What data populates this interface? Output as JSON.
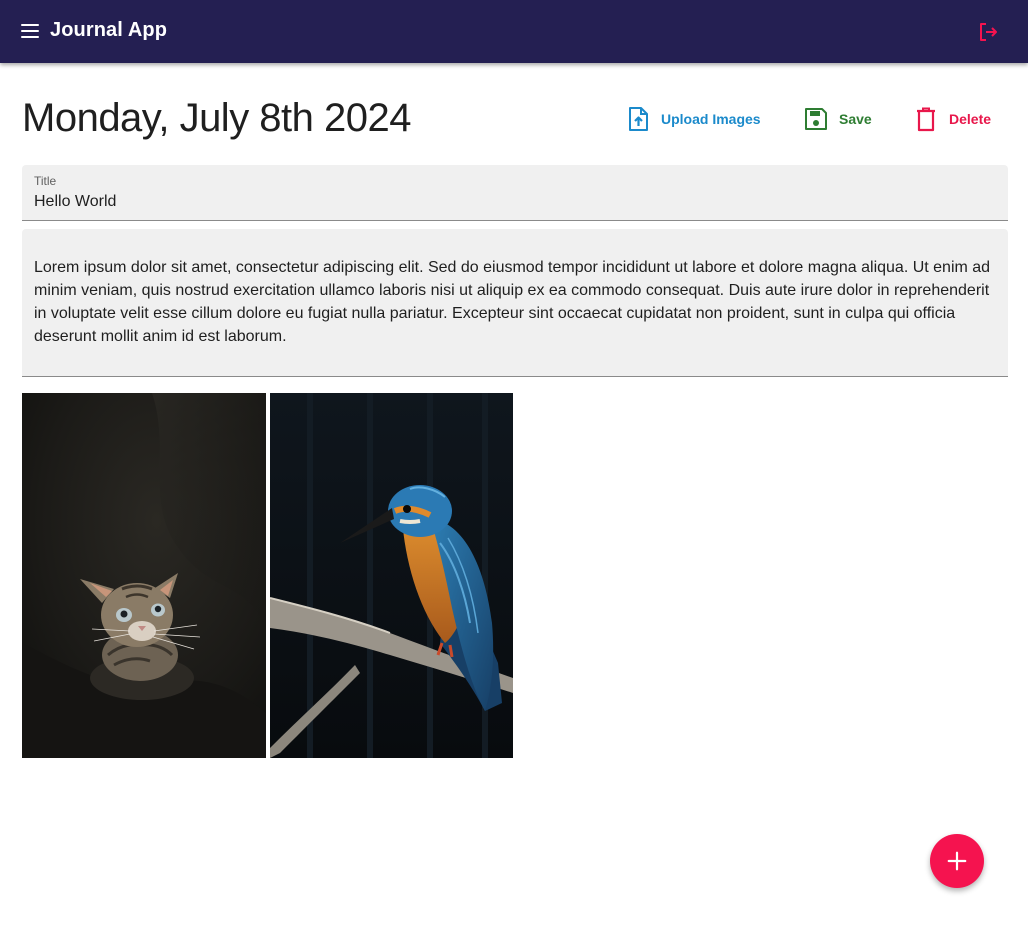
{
  "app": {
    "title": "Journal App",
    "accent_color": "#241f52",
    "logout_icon": "logout-icon",
    "menu_icon": "menu-icon"
  },
  "note": {
    "date": "Monday, July 8th 2024",
    "title_label": "Title",
    "title_value": "Hello World",
    "body": "Lorem ipsum dolor sit amet, consectetur adipiscing elit. Sed do eiusmod tempor incididunt ut labore et dolore magna aliqua. Ut enim ad minim veniam, quis nostrud exercitation ullamco laboris nisi ut aliquip ex ea commodo consequat. Duis aute irure dolor in reprehenderit in voluptate velit esse cillum dolore eu fugiat nulla pariatur. Excepteur sint occaecat cupidatat non proident, sunt in culpa qui officia deserunt mollit anim id est laborum."
  },
  "actions": {
    "upload_label": "Upload Images",
    "upload_color": "#1b8acb",
    "save_label": "Save",
    "save_color": "#2e7d32",
    "delete_label": "Delete",
    "delete_color": "#e8174b"
  },
  "images": [
    {
      "subject": "kitten photo"
    },
    {
      "subject": "kingfisher photo"
    }
  ],
  "fab": {
    "icon": "plus-icon",
    "color": "#f5134f"
  }
}
